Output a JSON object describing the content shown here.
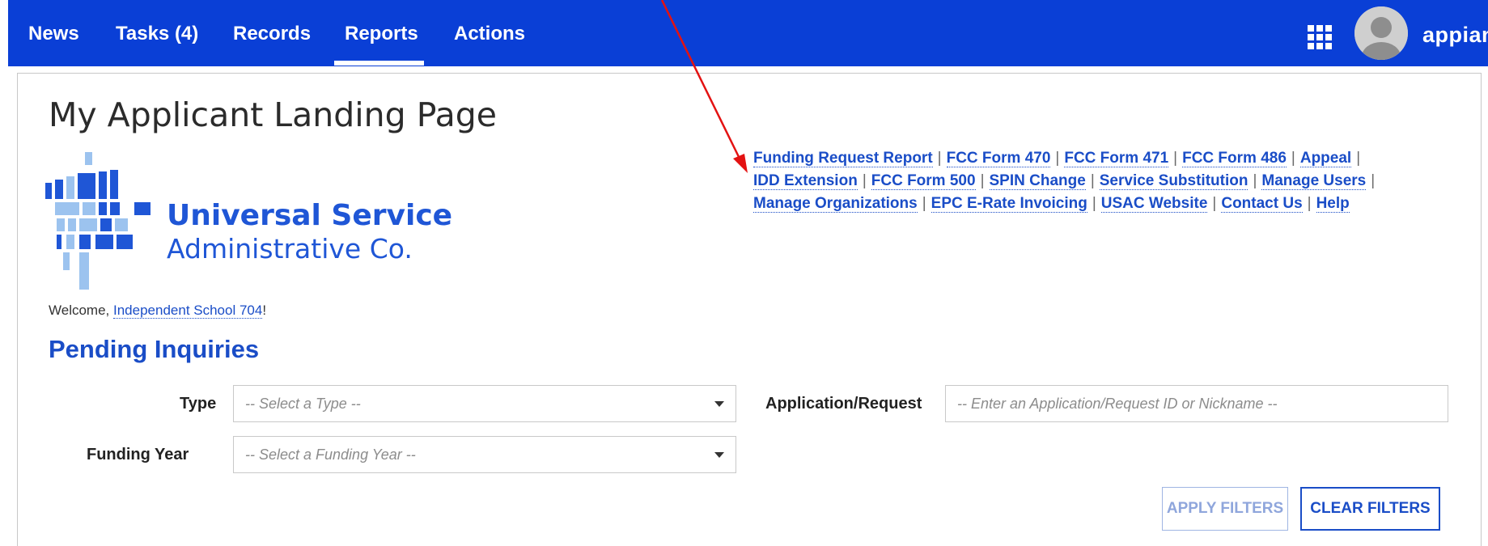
{
  "nav": {
    "items": [
      {
        "label": "News"
      },
      {
        "label": "Tasks (4)"
      },
      {
        "label": "Records"
      },
      {
        "label": "Reports"
      },
      {
        "label": "Actions"
      }
    ],
    "active": "Reports",
    "brand": "appian"
  },
  "page": {
    "title": "My Applicant Landing Page"
  },
  "logo": {
    "line1": "Universal Service",
    "line2": "Administrative Co.",
    "color": "#1f56d6"
  },
  "quick_links": [
    "Funding Request Report",
    "FCC Form 470",
    "FCC Form 471",
    "FCC Form 486",
    "Appeal",
    "IDD Extension",
    "FCC Form 500",
    "SPIN Change",
    "Service Substitution",
    "Manage Users",
    "Manage Organizations",
    "EPC E-Rate Invoicing",
    "USAC Website",
    "Contact Us",
    "Help"
  ],
  "welcome": {
    "prefix": "Welcome, ",
    "name": "Independent School 704",
    "suffix": "!"
  },
  "pending": {
    "title": "Pending Inquiries",
    "type_label": "Type",
    "type_placeholder": "-- Select a Type --",
    "year_label": "Funding Year",
    "year_placeholder": "-- Select a Funding Year --",
    "app_label": "Application/Request",
    "app_placeholder": "-- Enter an Application/Request ID or Nickname --",
    "apply_label": "APPLY FILTERS",
    "clear_label": "CLEAR FILTERS"
  },
  "colors": {
    "nav_bg": "#0a3fd6",
    "link": "#1a4dc7",
    "annotation_arrow": "#e31212"
  }
}
